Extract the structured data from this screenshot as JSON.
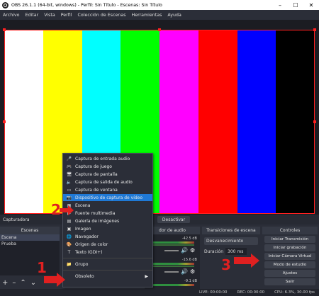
{
  "window": {
    "title": "OBS 26.1.1 (64-bit, windows) - Perfil: Sin Título - Escenas: Sin Título",
    "minimize_icon": "minimize-icon",
    "maximize_icon": "maximize-icon",
    "close_icon": "close-icon"
  },
  "menubar": {
    "items": [
      "Archivo",
      "Editar",
      "Vista",
      "Perfil",
      "Colección de Escenas",
      "Herramientas",
      "Ayuda"
    ]
  },
  "preview": {
    "bar_colors": [
      "#ffffff",
      "#ffff00",
      "#00ffff",
      "#00ff00",
      "#ff00ff",
      "#ff0000",
      "#0000ff",
      "#000000"
    ],
    "selection_color": "#ff2020"
  },
  "sources_bar": {
    "label": "Capturadora",
    "deactivate_label": "Desactivar"
  },
  "scenes": {
    "header": "Escenas",
    "items": [
      "Escena",
      "Prueba"
    ],
    "selected_index": 0
  },
  "audio": {
    "header": "Mezclador de audio",
    "header_visible": "dor de audio",
    "tracks": [
      {
        "db": "-42.5 dB"
      },
      {
        "db": "-15.6 dB"
      },
      {
        "db": "-9.1 dB"
      }
    ]
  },
  "transitions": {
    "header": "Transiciones de escena",
    "selected": "Desvanecimiento",
    "duration_label": "Duración",
    "duration_value": "300 ms"
  },
  "controls": {
    "header": "Controles",
    "buttons": [
      "Iniciar Transmisión",
      "Iniciar grabación",
      "Iniciar Cámara Virtual",
      "Modo de estudio",
      "Ajustes",
      "Salir"
    ]
  },
  "status": {
    "live": "LIVE: 00:00:00",
    "rec": "REC: 00:00:00",
    "cpu": "CPU: 6.3%, 30.00 fps"
  },
  "context_menu": {
    "items": [
      {
        "label": "Captura de entrada audio",
        "icon": "microphone-icon"
      },
      {
        "label": "Captura de juego",
        "icon": "gamepad-icon"
      },
      {
        "label": "Captura de pantalla",
        "icon": "monitor-icon"
      },
      {
        "label": "Captura de salida de audio",
        "icon": "speaker-icon"
      },
      {
        "label": "Captura de ventana",
        "icon": "window-icon"
      },
      {
        "label": "Dispositivo de captura de vídeo",
        "icon": "camera-icon"
      },
      {
        "label": "Escena",
        "icon": "scene-icon"
      },
      {
        "label": "Fuente multimedia",
        "icon": "play-icon"
      },
      {
        "label": "Galería de imágenes",
        "icon": "gallery-icon"
      },
      {
        "label": "Imagen",
        "icon": "image-icon"
      },
      {
        "label": "Navegador",
        "icon": "globe-icon"
      },
      {
        "label": "Origen de color",
        "icon": "palette-icon"
      },
      {
        "label": "Texto (GDI+)",
        "icon": "text-icon"
      },
      {
        "label": "Grupo",
        "icon": "folder-icon"
      },
      {
        "label": "Obsoleto",
        "icon": ""
      }
    ],
    "highlight_index": 5
  },
  "callouts": [
    "1",
    "2",
    "3"
  ],
  "accent_color": "#e02020"
}
